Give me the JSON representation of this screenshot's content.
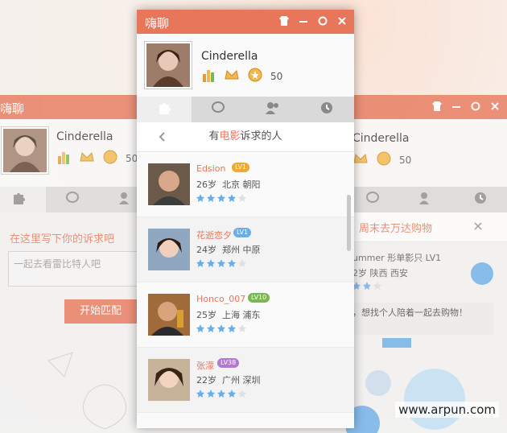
{
  "app": {
    "title": "嗨聊"
  },
  "profile": {
    "name": "Cinderella",
    "coins": "50"
  },
  "left": {
    "hint": "在这里写下你的诉求吧",
    "input_placeholder": "一起去看雷比特人吧",
    "match_button": "开始匹配"
  },
  "main": {
    "list_title_pre": "有",
    "list_title_hl": "电影",
    "list_title_post": "诉求的人",
    "people": [
      {
        "name": "Edsion",
        "age": "26岁",
        "location": "北京 朝阳",
        "stars": 4
      },
      {
        "name": "花逝恋夕",
        "age": "24岁",
        "location": "郑州 中原",
        "stars": 4
      },
      {
        "name": "Honco_007",
        "age": "25岁",
        "location": "上海 浦东",
        "stars": 4
      },
      {
        "name": "张濛",
        "age": "22岁",
        "location": "广州 深圳",
        "stars": 4
      }
    ]
  },
  "right": {
    "request_title": "周末去万达购物",
    "user_line": "ummer 形单影只 LV1",
    "info_line": "2岁 陕西 西安",
    "message": "，想找个人陪着一起去购物！"
  },
  "watermark": "www.arpun.com",
  "colors": {
    "accent": "#e8765a",
    "star": "#6aaee8"
  }
}
